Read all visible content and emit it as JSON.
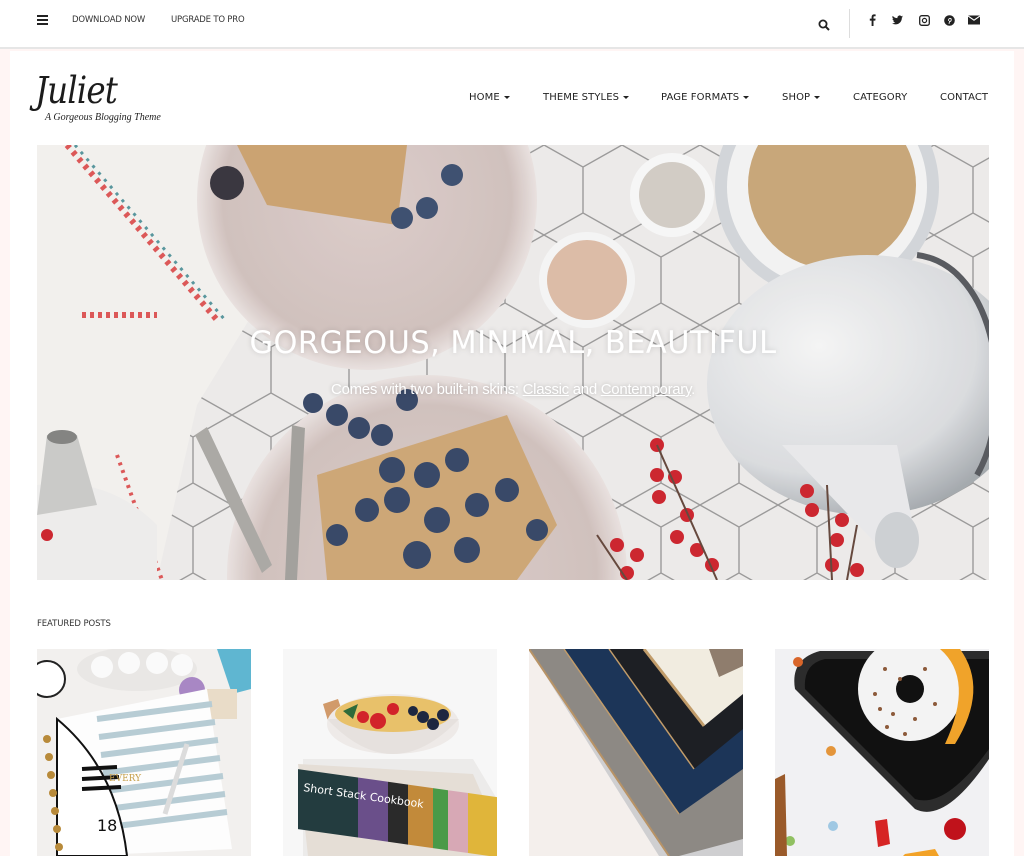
{
  "topbar": {
    "menu_icon": "hamburger-menu-icon",
    "links": [
      {
        "label": "Download Now"
      },
      {
        "label": "Upgrade to Pro"
      }
    ],
    "search_icon": "search-icon",
    "social_icons": [
      "facebook-icon",
      "twitter-icon",
      "instagram-icon",
      "pinterest-icon",
      "email-icon"
    ]
  },
  "site": {
    "title": "Juliet",
    "tagline": "A Gorgeous Blogging Theme"
  },
  "nav": {
    "items": [
      {
        "label": "Home",
        "has_dropdown": true
      },
      {
        "label": "Theme Styles",
        "has_dropdown": true
      },
      {
        "label": "Page Formats",
        "has_dropdown": true
      },
      {
        "label": "Shop",
        "has_dropdown": true
      },
      {
        "label": "Category",
        "has_dropdown": false
      },
      {
        "label": "Contact",
        "has_dropdown": false
      }
    ]
  },
  "hero": {
    "title": "GORGEOUS, MINIMAL, BEAUTIFUL",
    "subtitle_prefix": "Comes with two built-in skins: ",
    "link_classic": "Classic",
    "subtitle_and": " and ",
    "link_contemporary": "Contemporary",
    "subtitle_suffix": "."
  },
  "featured": {
    "heading": "Featured Posts",
    "posts": [
      {
        "image": "planner-notebook-flatlay"
      },
      {
        "image": "fruit-bowl-on-cookbooks"
      },
      {
        "image": "stacked-hardcover-books"
      },
      {
        "image": "sprinkled-donut-on-tray"
      }
    ]
  },
  "colors": {
    "page_background": "#fff5f4",
    "text": "#222222",
    "hero_text": "#ffffff"
  }
}
